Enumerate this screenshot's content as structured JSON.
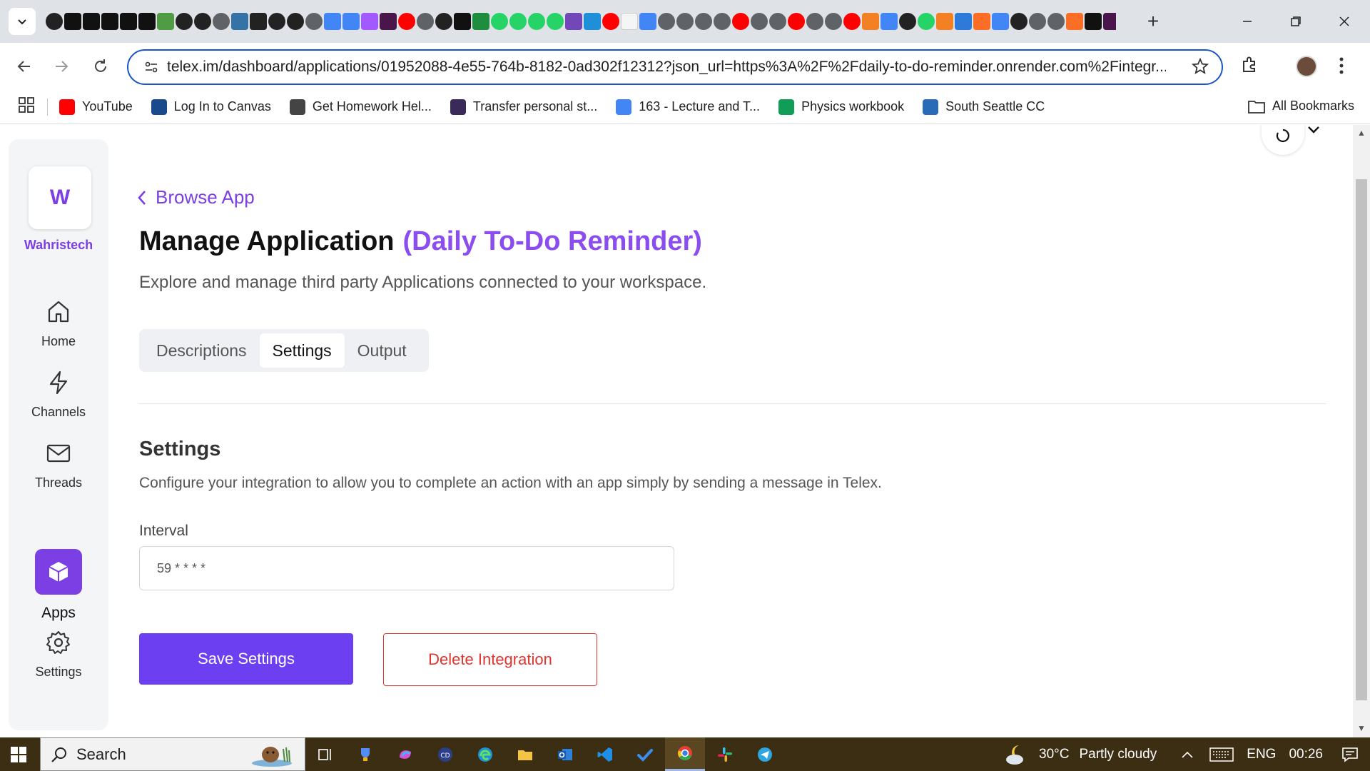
{
  "browser": {
    "url": "telex.im/dashboard/applications/01952088-4e55-764b-8182-0ad302f12312?json_url=https%3A%2F%2Fdaily-to-do-reminder.onrender.com%2Fintegr...",
    "tab_favicons": [
      "github",
      "medium",
      "medium",
      "medium",
      "medium",
      "medium",
      "overleaf",
      "github",
      "github",
      "chrome",
      "python",
      "monitor",
      "github",
      "github",
      "chrome",
      "google-docs",
      "google-docs",
      "figma",
      "slack",
      "youtube",
      "chrome",
      "github",
      "medium",
      "green-plus",
      "whatsapp",
      "whatsapp",
      "whatsapp",
      "whatsapp",
      "forms",
      "edge",
      "youtube",
      "white",
      "google",
      "chrome",
      "chrome",
      "chrome",
      "chrome",
      "youtube",
      "chrome",
      "chrome",
      "youtube",
      "chrome",
      "chrome",
      "youtube",
      "stackoverflow",
      "google",
      "github",
      "whatsapp",
      "stackoverflow",
      "arcgis",
      "gitlab",
      "google",
      "github",
      "chrome",
      "chrome",
      "gitlab",
      "dev",
      "slack",
      "chrome",
      "monitor",
      "chrome",
      "chrome",
      "github",
      "dev"
    ],
    "bookmarks": [
      {
        "label": "YouTube",
        "icon": "youtube-icon",
        "color": "#ff0000"
      },
      {
        "label": "Log In to Canvas",
        "icon": "canvas-icon",
        "color": "#1a4a8c"
      },
      {
        "label": "Get Homework Hel...",
        "icon": "chegg-icon",
        "color": "#444444"
      },
      {
        "label": "Transfer personal st...",
        "icon": "w-icon",
        "color": "#3a2a5a"
      },
      {
        "label": "163 - Lecture and T...",
        "icon": "docs-icon",
        "color": "#4285f4"
      },
      {
        "label": "Physics workbook",
        "icon": "drive-icon",
        "color": "#0f9d58"
      },
      {
        "label": "South Seattle CC",
        "icon": "sscc-icon",
        "color": "#2a6bb8"
      }
    ],
    "all_bookmarks": "All Bookmarks"
  },
  "sidebar": {
    "workspace_initial": "W",
    "workspace_name": "Wahristech",
    "items": [
      {
        "label": "Home",
        "icon": "home-icon"
      },
      {
        "label": "Channels",
        "icon": "lightning-icon"
      },
      {
        "label": "Threads",
        "icon": "mail-icon"
      },
      {
        "label": "Apps",
        "icon": "cube-icon"
      },
      {
        "label": "Settings",
        "icon": "gear-icon"
      }
    ]
  },
  "main": {
    "back_label": "Browse App",
    "title": "Manage Application",
    "app_name": "(Daily To-Do Reminder)",
    "subtitle": "Explore and manage third party Applications connected to your workspace.",
    "tabs": [
      {
        "label": "Descriptions",
        "active": false
      },
      {
        "label": "Settings",
        "active": true
      },
      {
        "label": "Output",
        "active": false
      }
    ],
    "section_title": "Settings",
    "section_desc": "Configure your integration to allow you to complete an action with an app simply by sending a message in Telex.",
    "interval_label": "Interval",
    "interval_value": "59 * * * *",
    "save_label": "Save Settings",
    "delete_label": "Delete Integration"
  },
  "taskbar": {
    "search_label": "Search",
    "temperature": "30°C",
    "weather": "Partly cloudy",
    "language": "ENG",
    "time": "00:26"
  },
  "colors": {
    "accent": "#7b3fe4",
    "button_primary": "#6c3ff0",
    "danger": "#e0342f"
  }
}
